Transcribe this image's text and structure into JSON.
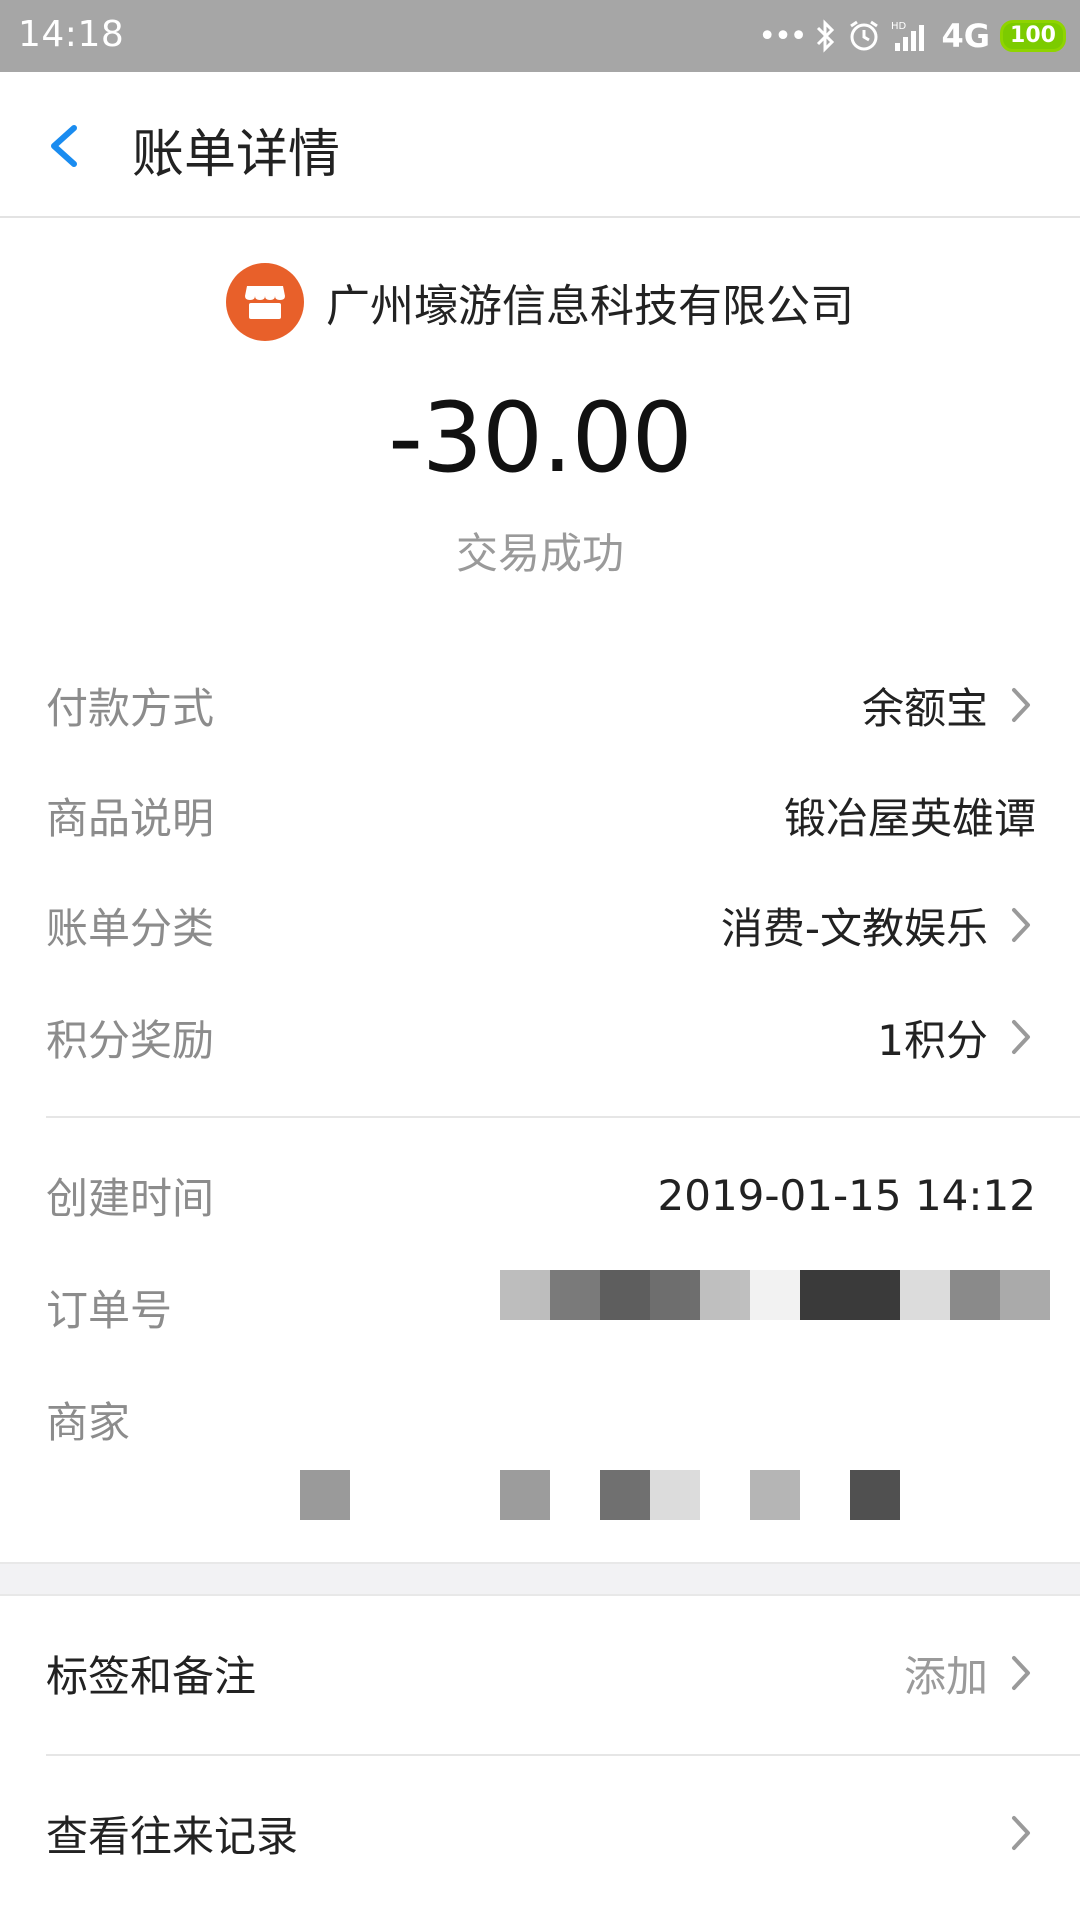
{
  "status_bar": {
    "time": "14:18",
    "network": "4G",
    "battery": "100",
    "hd_label": "HD",
    "icons": [
      "dots-icon",
      "bluetooth-icon",
      "alarm-icon",
      "signal-icon"
    ]
  },
  "header": {
    "title": "账单详情",
    "back_icon": "chevron-left-icon"
  },
  "merchant": {
    "name": "广州壕游信息科技有限公司",
    "logo_icon": "store-icon",
    "logo_color": "#e8602a"
  },
  "transaction": {
    "amount": "-30.00",
    "status": "交易成功"
  },
  "details": [
    {
      "label": "付款方式",
      "value": "余额宝"
    },
    {
      "label": "商品说明",
      "value": "锻冶屋英雄谭"
    },
    {
      "label": "账单分类",
      "value": "消费-文教娱乐"
    },
    {
      "label": "积分奖励",
      "value": "1积分"
    }
  ],
  "meta": [
    {
      "label": "创建时间",
      "value": "2019-01-15 14:12"
    },
    {
      "label": "订单号",
      "value": ""
    },
    {
      "label": "商家",
      "value": ""
    }
  ],
  "actions": [
    {
      "label": "标签和备注",
      "value": "添加"
    },
    {
      "label": "查看往来记录",
      "value": ""
    }
  ],
  "colors": {
    "accent": "#1a8cf0",
    "status_bar_bg": "#a6a6a6",
    "battery_green": "#7ccb00"
  }
}
